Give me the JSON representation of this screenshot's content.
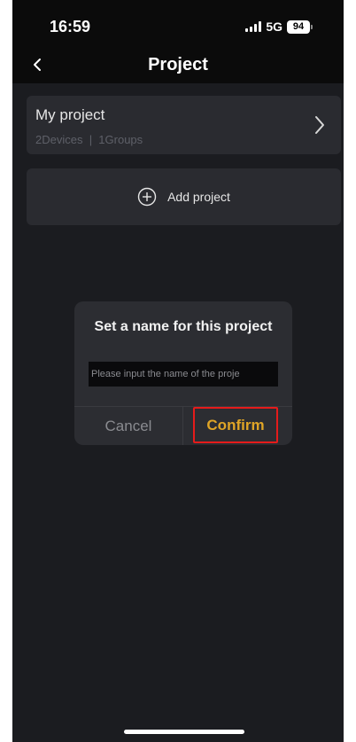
{
  "status_bar": {
    "time": "16:59",
    "network": "5G",
    "battery": "94"
  },
  "nav": {
    "title": "Project",
    "back_icon": "chevron-left-icon"
  },
  "projects": [
    {
      "name": "My project",
      "meta": "2Devices  |  1Groups",
      "icon": "chevron-right-icon"
    }
  ],
  "add_project": {
    "label": "Add project",
    "icon": "plus-circle-icon"
  },
  "dialog": {
    "title": "Set a name for this project",
    "input_placeholder": "Please input the name of the proje",
    "input_value": "",
    "cancel_label": "Cancel",
    "confirm_label": "Confirm"
  },
  "colors": {
    "background": "#1b1c20",
    "card": "#2a2b30",
    "accent": "#e0a526",
    "highlight_box": "#e51b1b"
  }
}
